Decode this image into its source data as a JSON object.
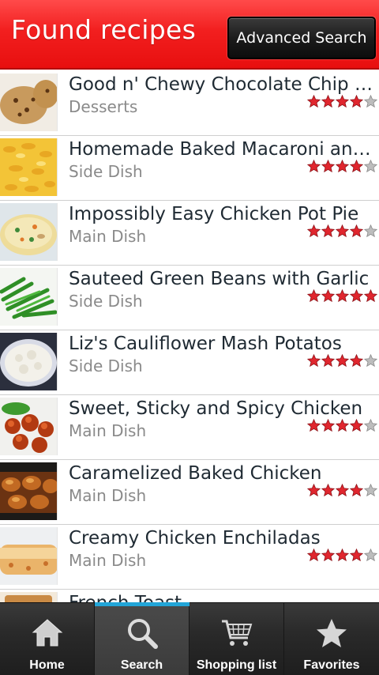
{
  "header": {
    "title": "Found recipes",
    "advanced_search_label": "Advanced Search"
  },
  "recipes": [
    {
      "title": "Good n' Chewy Chocolate Chip Cookies",
      "category": "Desserts",
      "rating": 4,
      "thumb": "cookies"
    },
    {
      "title": "Homemade Baked Macaroni and Cheese",
      "category": "Side Dish",
      "rating": 4,
      "thumb": "macaroni"
    },
    {
      "title": "Impossibly Easy Chicken Pot Pie",
      "category": "Main Dish",
      "rating": 4,
      "thumb": "potpie"
    },
    {
      "title": "Sauteed Green Beans with Garlic",
      "category": "Side Dish",
      "rating": 5,
      "thumb": "greenbeans"
    },
    {
      "title": "Liz's Cauliflower Mash Potatos",
      "category": "Side Dish",
      "rating": 4,
      "thumb": "mash"
    },
    {
      "title": "Sweet, Sticky and Spicy Chicken",
      "category": "Main Dish",
      "rating": 4,
      "thumb": "chicken"
    },
    {
      "title": "Caramelized Baked Chicken",
      "category": "Main Dish",
      "rating": 4,
      "thumb": "bakedchicken"
    },
    {
      "title": "Creamy Chicken Enchiladas",
      "category": "Main Dish",
      "rating": 4,
      "thumb": "enchiladas"
    },
    {
      "title": "French Toast",
      "category": "",
      "rating": 0,
      "thumb": "toast"
    }
  ],
  "nav": {
    "items": [
      {
        "label": "Home",
        "icon": "home-icon"
      },
      {
        "label": "Search",
        "icon": "search-icon"
      },
      {
        "label": "Shopping list",
        "icon": "cart-icon"
      },
      {
        "label": "Favorites",
        "icon": "star-icon"
      }
    ],
    "active_index": 1
  },
  "colors": {
    "header_red": "#ee1717",
    "star_filled": "#e0262e",
    "star_empty": "#bdbdbd",
    "nav_active_accent": "#22a5d8"
  }
}
